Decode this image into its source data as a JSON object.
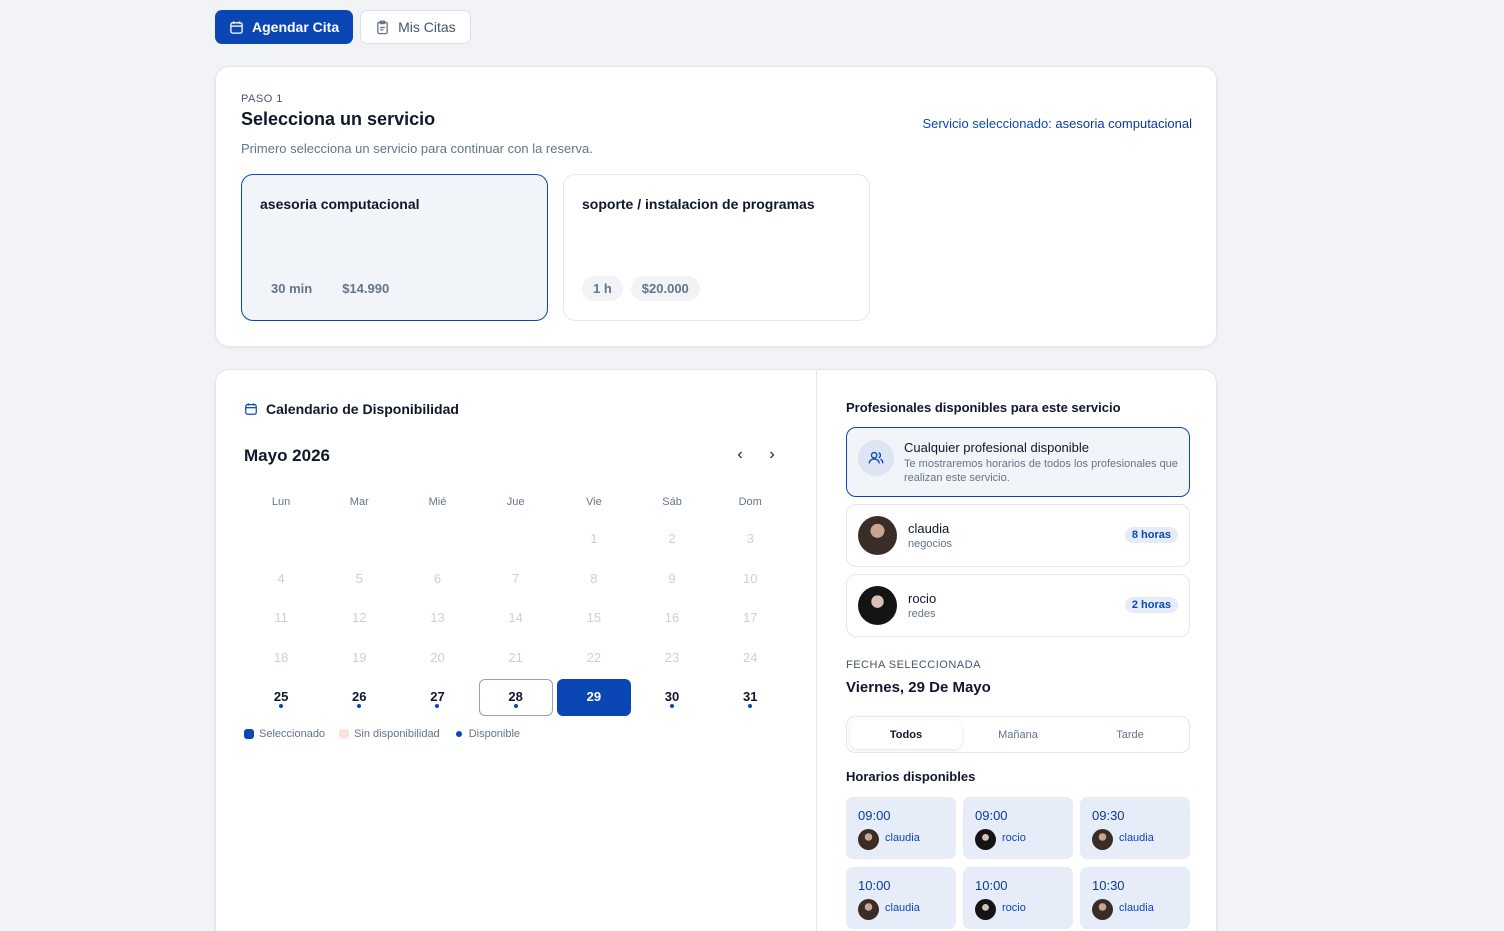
{
  "nav": {
    "book_label": "Agendar Cita",
    "mine_label": "Mis Citas"
  },
  "step": {
    "label": "PASO 1",
    "title": "Selecciona un servicio",
    "description": "Primero selecciona un servicio para continuar con la reserva.",
    "selected_prefix": "Servicio seleccionado:",
    "selected_value": "asesoria computacional"
  },
  "services": [
    {
      "name": "asesoria computacional",
      "duration": "30 min",
      "price": "$14.990",
      "selected": true
    },
    {
      "name": "soporte / instalacion de programas",
      "duration": "1 h",
      "price": "$20.000",
      "selected": false
    }
  ],
  "calendar": {
    "title": "Calendario de Disponibilidad",
    "month": "Mayo 2026",
    "prev": "‹",
    "next": "›",
    "weekdays": [
      "Lun",
      "Mar",
      "Mié",
      "Jue",
      "Vie",
      "Sáb",
      "Dom"
    ],
    "leading_blanks": 4,
    "days": [
      {
        "n": "1",
        "s": "off"
      },
      {
        "n": "2",
        "s": "off"
      },
      {
        "n": "3",
        "s": "off"
      },
      {
        "n": "4",
        "s": "off"
      },
      {
        "n": "5",
        "s": "off"
      },
      {
        "n": "6",
        "s": "off"
      },
      {
        "n": "7",
        "s": "off"
      },
      {
        "n": "8",
        "s": "off"
      },
      {
        "n": "9",
        "s": "off"
      },
      {
        "n": "10",
        "s": "off"
      },
      {
        "n": "11",
        "s": "off"
      },
      {
        "n": "12",
        "s": "off"
      },
      {
        "n": "13",
        "s": "off"
      },
      {
        "n": "14",
        "s": "off"
      },
      {
        "n": "15",
        "s": "off"
      },
      {
        "n": "16",
        "s": "off"
      },
      {
        "n": "17",
        "s": "off"
      },
      {
        "n": "18",
        "s": "off"
      },
      {
        "n": "19",
        "s": "off"
      },
      {
        "n": "20",
        "s": "off"
      },
      {
        "n": "21",
        "s": "off"
      },
      {
        "n": "22",
        "s": "off"
      },
      {
        "n": "23",
        "s": "off"
      },
      {
        "n": "24",
        "s": "off"
      },
      {
        "n": "25",
        "s": "avail"
      },
      {
        "n": "26",
        "s": "avail"
      },
      {
        "n": "27",
        "s": "avail"
      },
      {
        "n": "28",
        "s": "today"
      },
      {
        "n": "29",
        "s": "sel"
      },
      {
        "n": "30",
        "s": "avail"
      },
      {
        "n": "31",
        "s": "avail"
      }
    ],
    "legend": {
      "selected": "Seleccionado",
      "unavailable": "Sin disponibilidad",
      "available": "Disponible"
    }
  },
  "professionals": {
    "title": "Profesionales disponibles para este servicio",
    "any": {
      "title": "Cualquier profesional disponible",
      "description": "Te mostraremos horarios de todos los profesionales que realizan este servicio."
    },
    "list": [
      {
        "name": "claudia",
        "specialty": "negocios",
        "hours": "8 horas"
      },
      {
        "name": "rocio",
        "specialty": "redes",
        "hours": "2 horas"
      }
    ]
  },
  "selected_date": {
    "label": "FECHA SELECCIONADA",
    "value": "Viernes, 29 De Mayo"
  },
  "filters": [
    "Todos",
    "Mañana",
    "Tarde"
  ],
  "slots_title": "Horarios disponibles",
  "slots": [
    {
      "time": "09:00",
      "who": "claudia"
    },
    {
      "time": "09:00",
      "who": "rocio"
    },
    {
      "time": "09:30",
      "who": "claudia"
    },
    {
      "time": "10:00",
      "who": "claudia"
    },
    {
      "time": "10:00",
      "who": "rocio"
    },
    {
      "time": "10:30",
      "who": "claudia"
    }
  ],
  "colors": {
    "primary": "#0a47b4",
    "background": "#f1f3f7",
    "slot_bg": "#e6edf9",
    "unavailable_legend": "#fde2dc"
  }
}
